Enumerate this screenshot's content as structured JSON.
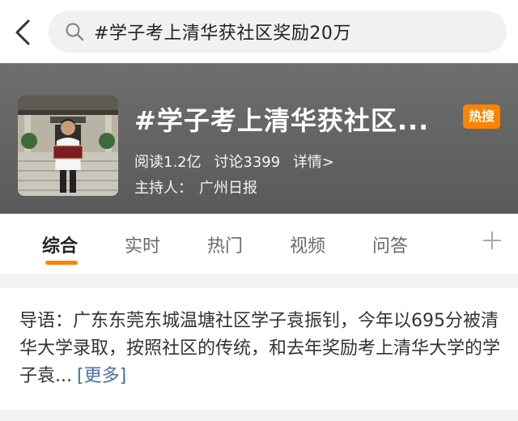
{
  "search": {
    "query": "#学子考上清华获社区奖励20万"
  },
  "topic": {
    "title": "#学子考上清华获社区...",
    "hot_badge": "热搜",
    "stats": {
      "reads": "阅读1.2亿",
      "discussions": "讨论3399",
      "details": "详情>"
    },
    "host_label": "主持人：",
    "host_name": "广州日报",
    "thumbnail_icon": "student-photo"
  },
  "tabs": [
    {
      "label": "综合",
      "active": true
    },
    {
      "label": "实时",
      "active": false
    },
    {
      "label": "热门",
      "active": false
    },
    {
      "label": "视频",
      "active": false
    },
    {
      "label": "问答",
      "active": false
    }
  ],
  "intro": {
    "text": "导语：广东东莞东城温塘社区学子袁振钊，今年以695分被清华大学录取，按照社区的传统，和去年奖励考上清华大学的学子袁...",
    "more": "[更多]"
  },
  "colors": {
    "accent": "#ff8200",
    "link": "#4a6fa5",
    "header_bg": "#646464"
  }
}
